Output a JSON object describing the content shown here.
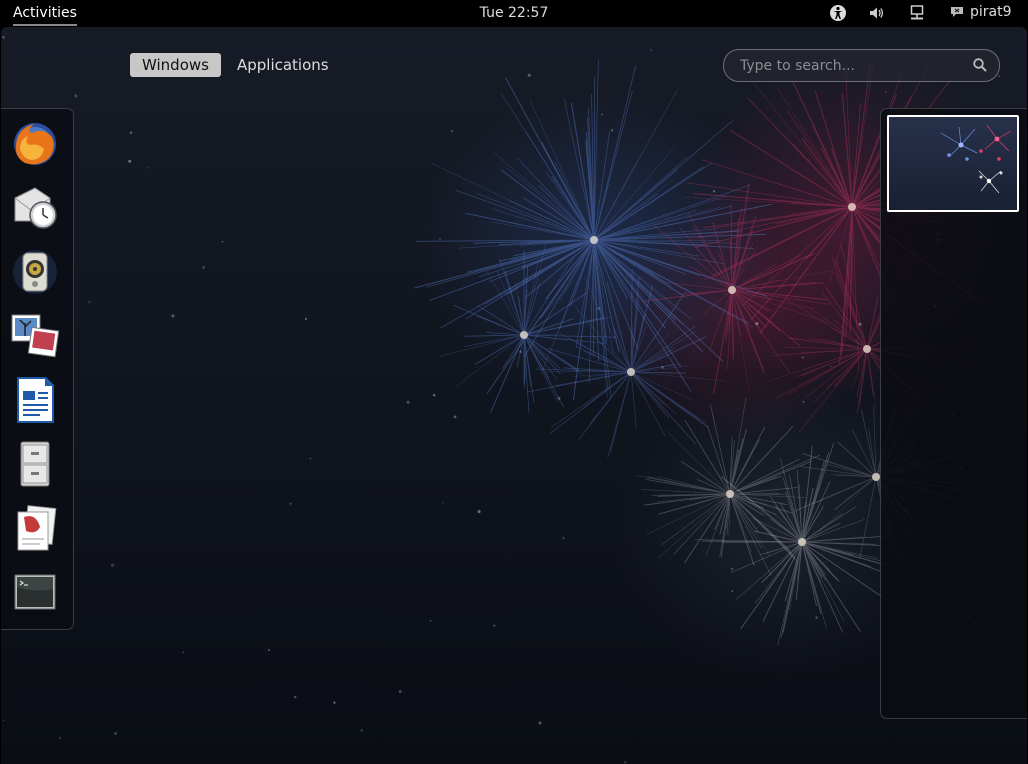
{
  "topbar": {
    "activities_label": "Activities",
    "clock": "Tue 22:57",
    "username": "pirat9",
    "tray_icons": [
      "accessibility-icon",
      "volume-icon",
      "network-icon",
      "chat-status-icon"
    ]
  },
  "overview": {
    "tabs": [
      {
        "label": "Windows",
        "active": true
      },
      {
        "label": "Applications",
        "active": false
      }
    ],
    "search": {
      "placeholder": "Type to search..."
    }
  },
  "dash": {
    "apps": [
      "firefox-icon",
      "evolution-mail-clock-icon",
      "rhythmbox-speaker-icon",
      "shotwell-photos-icon",
      "libreoffice-writer-icon",
      "file-cabinet-icon",
      "documents-icon",
      "terminal-icon"
    ]
  },
  "colors": {
    "topbar_bg": "#000000",
    "active_tab_bg": "#c7c7c7",
    "panel_bg": "#0a0c12",
    "firework_blue": "#5a7fd0",
    "firework_red": "#c03560",
    "firework_white": "#d8dce4"
  }
}
